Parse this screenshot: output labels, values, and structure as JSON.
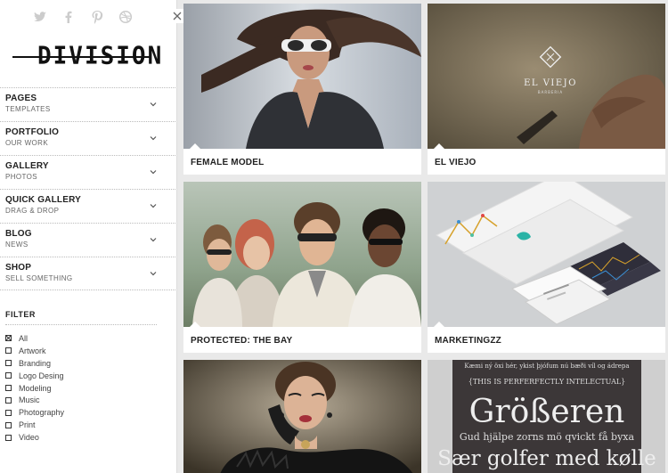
{
  "sidebar": {
    "social": [
      {
        "icon": "twitter-icon"
      },
      {
        "icon": "facebook-icon"
      },
      {
        "icon": "pinterest-icon"
      },
      {
        "icon": "dribbble-icon"
      }
    ],
    "logo": "DIVISION",
    "nav": [
      {
        "title": "PAGES",
        "subtitle": "TEMPLATES"
      },
      {
        "title": "PORTFOLIO",
        "subtitle": "OUR WORK"
      },
      {
        "title": "GALLERY",
        "subtitle": "PHOTOS"
      },
      {
        "title": "QUICK GALLERY",
        "subtitle": "DRAG & DROP"
      },
      {
        "title": "BLOG",
        "subtitle": "NEWS"
      },
      {
        "title": "SHOP",
        "subtitle": "SELL SOMETHING"
      }
    ],
    "filter": {
      "title": "FILTER",
      "items": [
        {
          "label": "All",
          "checked": true
        },
        {
          "label": "Artwork",
          "checked": false
        },
        {
          "label": "Branding",
          "checked": false
        },
        {
          "label": "Logo Desing",
          "checked": false
        },
        {
          "label": "Modeling",
          "checked": false
        },
        {
          "label": "Music",
          "checked": false
        },
        {
          "label": "Photography",
          "checked": false
        },
        {
          "label": "Print",
          "checked": false
        },
        {
          "label": "Video",
          "checked": false
        }
      ]
    }
  },
  "portfolio": {
    "items": [
      {
        "title": "FEMALE MODEL"
      },
      {
        "title": "EL VIEJO",
        "logo_text": "EL VIEJO",
        "logo_sub": "BARBERIA"
      },
      {
        "title": "PROTECTED: THE BAY"
      },
      {
        "title": "MARKETINGZZ"
      },
      {
        "title": ""
      },
      {
        "title": "",
        "poster": {
          "line1": "Kæmi ný öxi hér, ykist þjófum nú bæði víl og ádrepa",
          "line2": "{THIS IS PERFERFECTLY INTELECTUAL}",
          "line3": "Größeren",
          "line4": "Gud hjälpe zorns mö qvickt få byxa",
          "line5": "Sær golfer med kølle"
        }
      }
    ]
  },
  "colors": {
    "accent": "#222222",
    "background": "#e9e9e9"
  }
}
